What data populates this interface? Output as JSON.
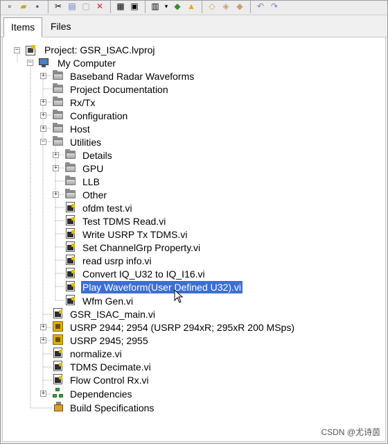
{
  "tabs": [
    {
      "label": "Items",
      "active": true
    },
    {
      "label": "Files",
      "active": false
    }
  ],
  "toolbar": {
    "icons": [
      "new-icon",
      "open-icon",
      "save-icon",
      "cut-icon",
      "copy-icon",
      "paste-icon",
      "delete-icon",
      "build-icon",
      "deploy-icon",
      "view-icon",
      "dropdown-icon",
      "filter-icon",
      "warning-icon",
      "pkg1-icon",
      "pkg2-icon",
      "pkg3-icon",
      "undo-icon",
      "redo-icon"
    ]
  },
  "tree": {
    "project": {
      "label": "Project: GSR_ISAC.lvproj"
    },
    "computer": {
      "label": "My Computer"
    },
    "items": {
      "baseband": "Baseband Radar Waveforms",
      "projdocs": "Project Documentation",
      "rxtx": "Rx/Tx",
      "configuration": "Configuration",
      "host": "Host",
      "utilities": "Utilities",
      "details": "Details",
      "gpu": "GPU",
      "llb": "LLB",
      "other": "Other",
      "ofdm_test": "ofdm test.vi",
      "test_tdms_read": "Test TDMS Read.vi",
      "write_usrp_tx_tdms": "Write USRP Tx TDMS.vi",
      "set_channelgrp": "Set ChannelGrp Property.vi",
      "read_usrp_info": "read usrp info.vi",
      "convert_iq": "Convert IQ_U32 to IQ_I16.vi",
      "play_waveform": "Play Waveform(User Defined U32).vi",
      "wfm_gen": "Wfm Gen.vi",
      "gsr_isac_main": "GSR_ISAC_main.vi",
      "usrp_2944": "USRP 2944; 2954 (USRP 294xR; 295xR 200 MSps)",
      "usrp_2945": "USRP 2945; 2955",
      "normalize": "normalize.vi",
      "tdms_decimate": "TDMS Decimate.vi",
      "flow_control": "Flow Control Rx.vi",
      "dependencies": "Dependencies",
      "build_specs": "Build Specifications"
    },
    "selected_item": "Play Waveform(User Defined U32).vi"
  },
  "watermark": "CSDN @尤诗茵",
  "colors": {
    "selection": "#3c6fd0",
    "window_bg": "#f0f0f0",
    "panel_bg": "#ffffff",
    "usrp_icon": "#e1b000"
  }
}
